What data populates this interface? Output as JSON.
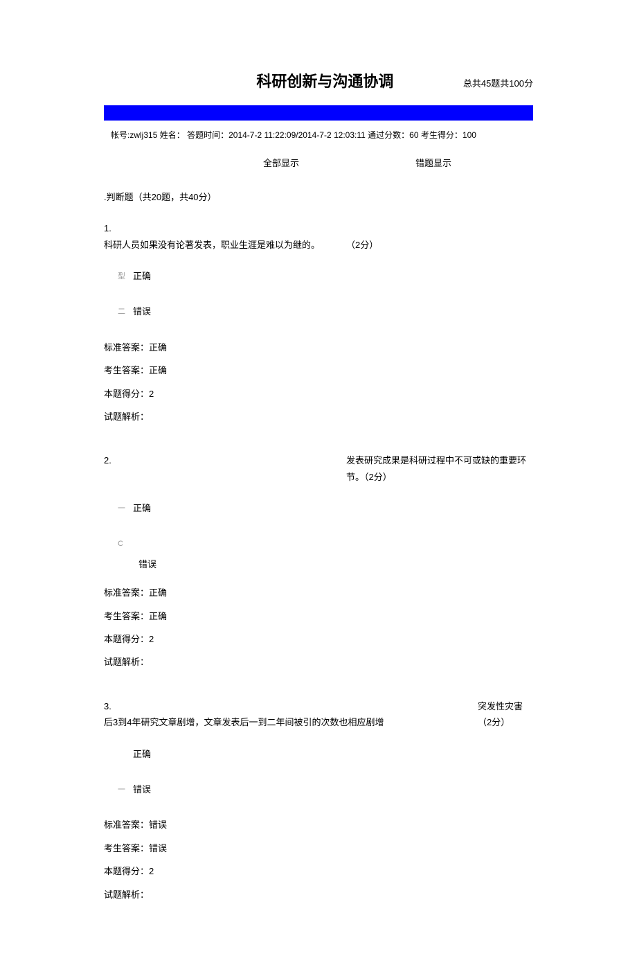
{
  "header": {
    "title": "科研创新与沟通协调",
    "summary": "总共45题共100分"
  },
  "meta": {
    "account_label": "帐号:",
    "account": "zwlj315",
    "name_label": "姓名：",
    "name": "",
    "time_label": "答题时间：",
    "time": "2014-7-2 11:22:09/2014-7-2 12:03:11",
    "pass_label": "通过分数：",
    "pass": "60",
    "score_label": "考生得分：",
    "score": "100"
  },
  "tabs": {
    "all": "全部显示",
    "wrong": "错题显示"
  },
  "section": {
    "header": ".判断题（共20题，共40分）"
  },
  "labels": {
    "std_answer": "标准答案：",
    "user_answer": "考生答案：",
    "points_got": "本题得分：",
    "analysis": "试题解析："
  },
  "opts": {
    "correct": "正确",
    "wrong": "错误"
  },
  "q1": {
    "num": "1.",
    "text": "科研人员如果没有论著发表，职业生涯是难以为继的。",
    "pts": "（2分）",
    "opt1_mark": "型",
    "opt2_mark": "二",
    "std": "正确",
    "user": "正确",
    "score": "2",
    "analysis": ""
  },
  "q2": {
    "num": "2.",
    "text": "发表研究成果是科研过程中不可或缺的重要环节。（2分）",
    "opt1_mark": "一",
    "opt2_sup": "C",
    "std": "正确",
    "user": "正确",
    "score": "2",
    "analysis": ""
  },
  "q3": {
    "num": "3.",
    "text": "后3到4年研究文章剧增，文章发表后一到二年间被引的次数也相应剧增",
    "right_text": "突发性灾害（2分）",
    "opt2_mark": "一",
    "std": "错误",
    "user": "错误",
    "score": "2",
    "analysis": ""
  }
}
